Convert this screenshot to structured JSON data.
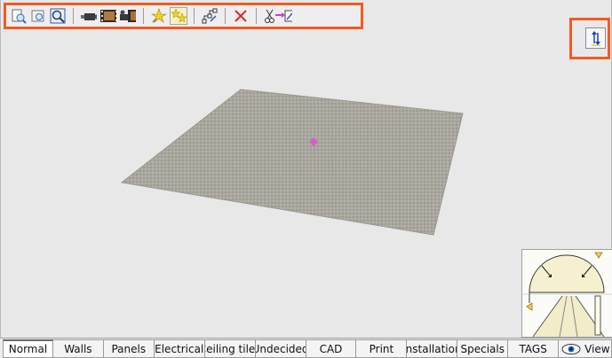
{
  "toolbar": {
    "buttons": [
      {
        "icon": "zoom-in-icon"
      },
      {
        "icon": "zoom-window-icon"
      },
      {
        "icon": "zoom-extents-icon"
      },
      {
        "icon": "camera-icon"
      },
      {
        "icon": "film-icon"
      },
      {
        "icon": "movie-camera-icon"
      },
      {
        "icon": "light-star-icon"
      },
      {
        "icon": "multi-light-icon"
      },
      {
        "icon": "transform-points-icon"
      },
      {
        "icon": "delete-icon"
      },
      {
        "icon": "cut-paste-icon"
      }
    ],
    "accent_color": "#f25a24"
  },
  "view_toggle": {
    "icon": "swap-vertical-icon"
  },
  "navigator": {
    "icons": [
      "rotate-arrows-icon",
      "pan-triangle-icon"
    ]
  },
  "tabs": [
    {
      "label": "Normal",
      "selected": true
    },
    {
      "label": "Walls"
    },
    {
      "label": "Panels"
    },
    {
      "label": "Electrical"
    },
    {
      "label": "Ceiling tiles"
    },
    {
      "label": "Undecided"
    },
    {
      "label": "CAD"
    },
    {
      "label": "Print"
    },
    {
      "label": "Installation"
    },
    {
      "label": "Specials"
    },
    {
      "label": "TAGS"
    },
    {
      "label": "View",
      "icon": "eye-icon"
    }
  ]
}
